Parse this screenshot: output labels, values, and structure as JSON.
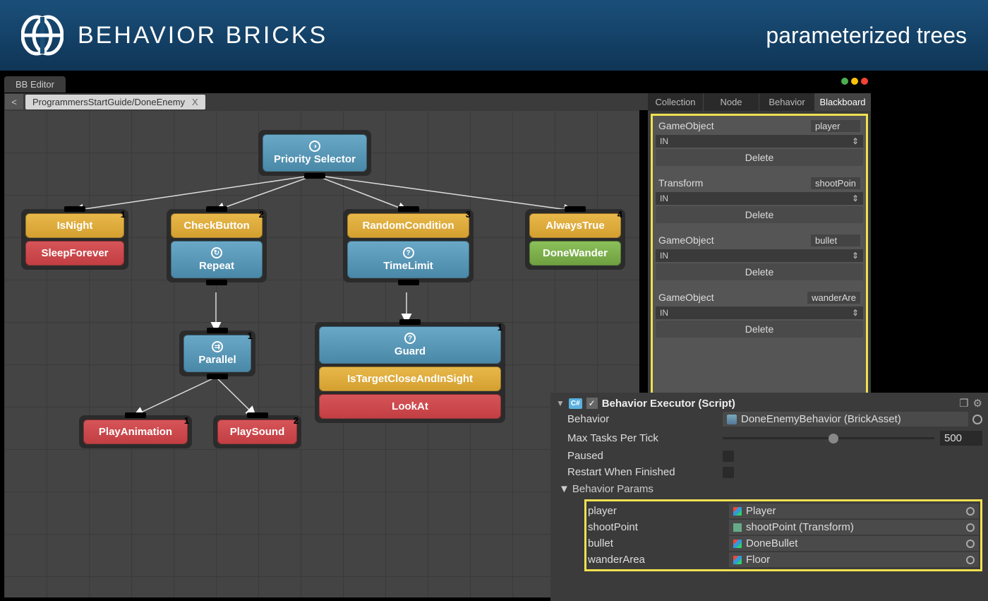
{
  "banner": {
    "title": "BEHAVIOR BRICKS",
    "subtitle": "parameterized trees"
  },
  "editor": {
    "tab_label": "BB Editor",
    "breadcrumb": "ProgrammersStartGuide/DoneEnemy",
    "breadcrumb_close": "X",
    "nav_prev": "<",
    "nav_next": ">"
  },
  "canvas": {
    "root": {
      "label": "Priority Selector"
    },
    "branch1": {
      "badge": "1",
      "condition": "IsNight",
      "action": "SleepForever"
    },
    "branch2": {
      "badge": "2",
      "condition": "CheckButton",
      "decorator": "Repeat",
      "parallel": {
        "badge": "1",
        "label": "Parallel"
      },
      "leaf1": {
        "badge": "1",
        "label": "PlayAnimation"
      },
      "leaf2": {
        "badge": "2",
        "label": "PlaySound"
      }
    },
    "branch3": {
      "badge": "3",
      "condition": "RandomCondition",
      "decorator": "TimeLimit",
      "guard": {
        "badge": "1",
        "label": "Guard"
      },
      "sub1": "IsTargetCloseAndInSight",
      "sub2": "LookAt"
    },
    "branch4": {
      "badge": "4",
      "condition": "AlwaysTrue",
      "action": "DoneWander"
    }
  },
  "side_panel": {
    "tabs": [
      "Collection",
      "Node",
      "Behavior",
      "Blackboard"
    ],
    "active_tab": "Blackboard",
    "entries": [
      {
        "type": "GameObject",
        "name": "player",
        "direction": "IN",
        "delete": "Delete"
      },
      {
        "type": "Transform",
        "name": "shootPoin",
        "direction": "IN",
        "delete": "Delete"
      },
      {
        "type": "GameObject",
        "name": "bullet",
        "direction": "IN",
        "delete": "Delete"
      },
      {
        "type": "GameObject",
        "name": "wanderAre",
        "direction": "IN",
        "delete": "Delete"
      }
    ]
  },
  "inspector": {
    "component_title": "Behavior Executor (Script)",
    "behavior_label": "Behavior",
    "behavior_value": "DoneEnemyBehavior (BrickAsset)",
    "max_tasks_label": "Max Tasks Per Tick",
    "max_tasks_value": "500",
    "paused_label": "Paused",
    "restart_label": "Restart When Finished",
    "params_header": "Behavior Params",
    "params": [
      {
        "name": "player",
        "value": "Player",
        "icon": "prefab"
      },
      {
        "name": "shootPoint",
        "value": "shootPoint (Transform)",
        "icon": "transform"
      },
      {
        "name": "bullet",
        "value": "DoneBullet",
        "icon": "prefab"
      },
      {
        "name": "wanderArea",
        "value": "Floor",
        "icon": "prefab"
      }
    ]
  }
}
